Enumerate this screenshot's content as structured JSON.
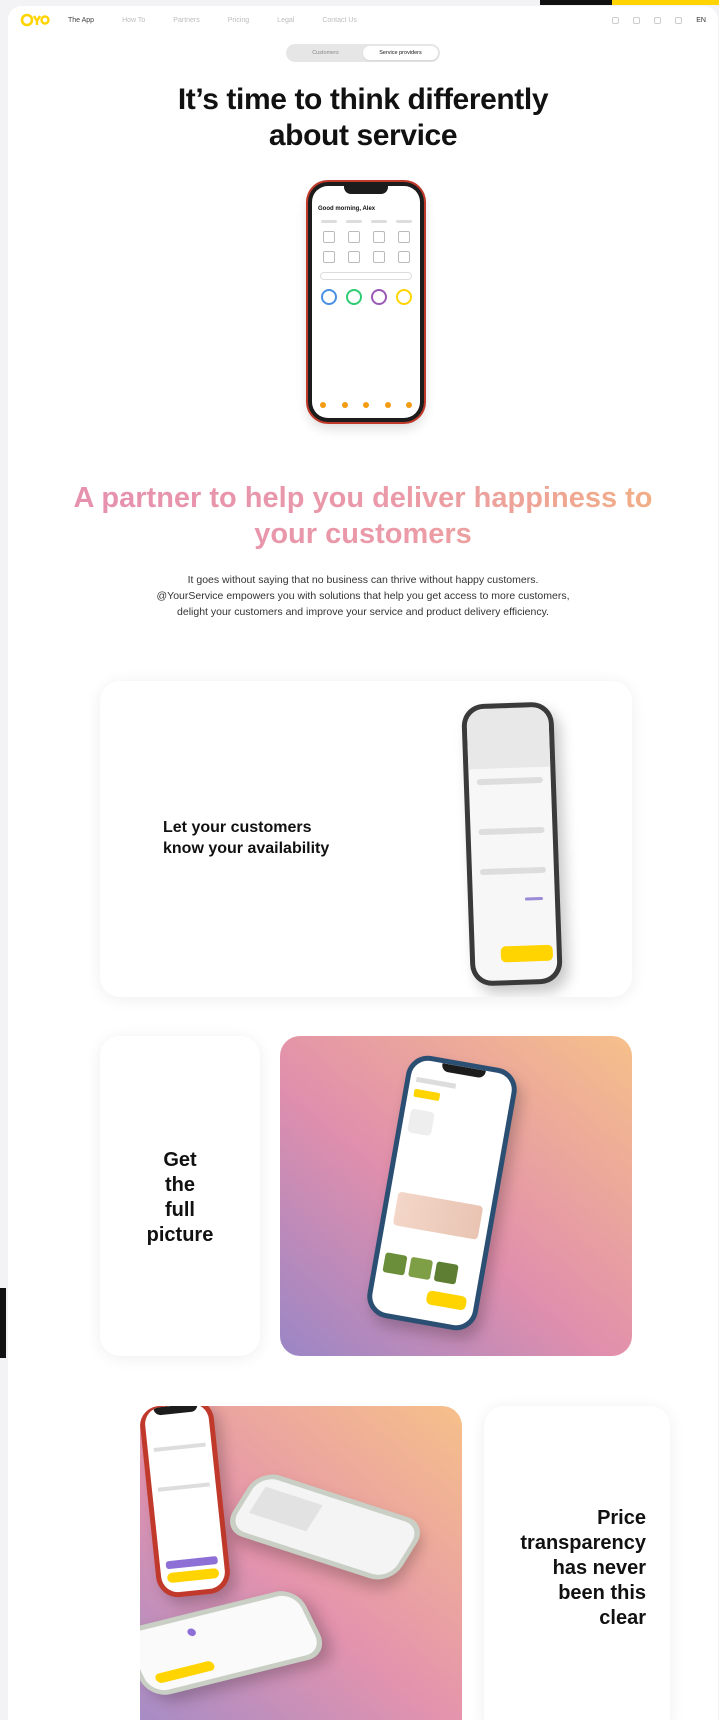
{
  "nav": {
    "links": [
      "The App",
      "How To",
      "Partners",
      "Pricing",
      "Legal",
      "Contact Us"
    ],
    "lang": "EN"
  },
  "toggle": {
    "left": "Customers",
    "right": "Service providers"
  },
  "hero": {
    "title_line1": "It’s time to think differently",
    "title_line2": "about service"
  },
  "phone_hero": {
    "title": "Good morning, Alex"
  },
  "partner": {
    "title_line1": "A partner to help you deliver happiness to",
    "title_line2": "your customers"
  },
  "intro": {
    "line1": "It goes without saying that no business can thrive without happy customers.",
    "line2": "@YourService empowers you with solutions that help you get access to more customers,",
    "line3": "delight your customers and improve your service and product delivery efficiency."
  },
  "cards": {
    "availability": {
      "line1": "Let your customers",
      "line2": "know your availability"
    },
    "picture": {
      "line1": "Get",
      "line2": "the",
      "line3": "full",
      "line4": "picture"
    },
    "price": {
      "line1": "Price",
      "line2": "transparency",
      "line3": "has never",
      "line4": "been this",
      "line5": "clear"
    }
  },
  "colors": {
    "accent_yellow": "#ffd400",
    "grad_pink": "#e58fb0",
    "grad_orange": "#f4b37e",
    "grad_purple": "#9a86c6"
  }
}
